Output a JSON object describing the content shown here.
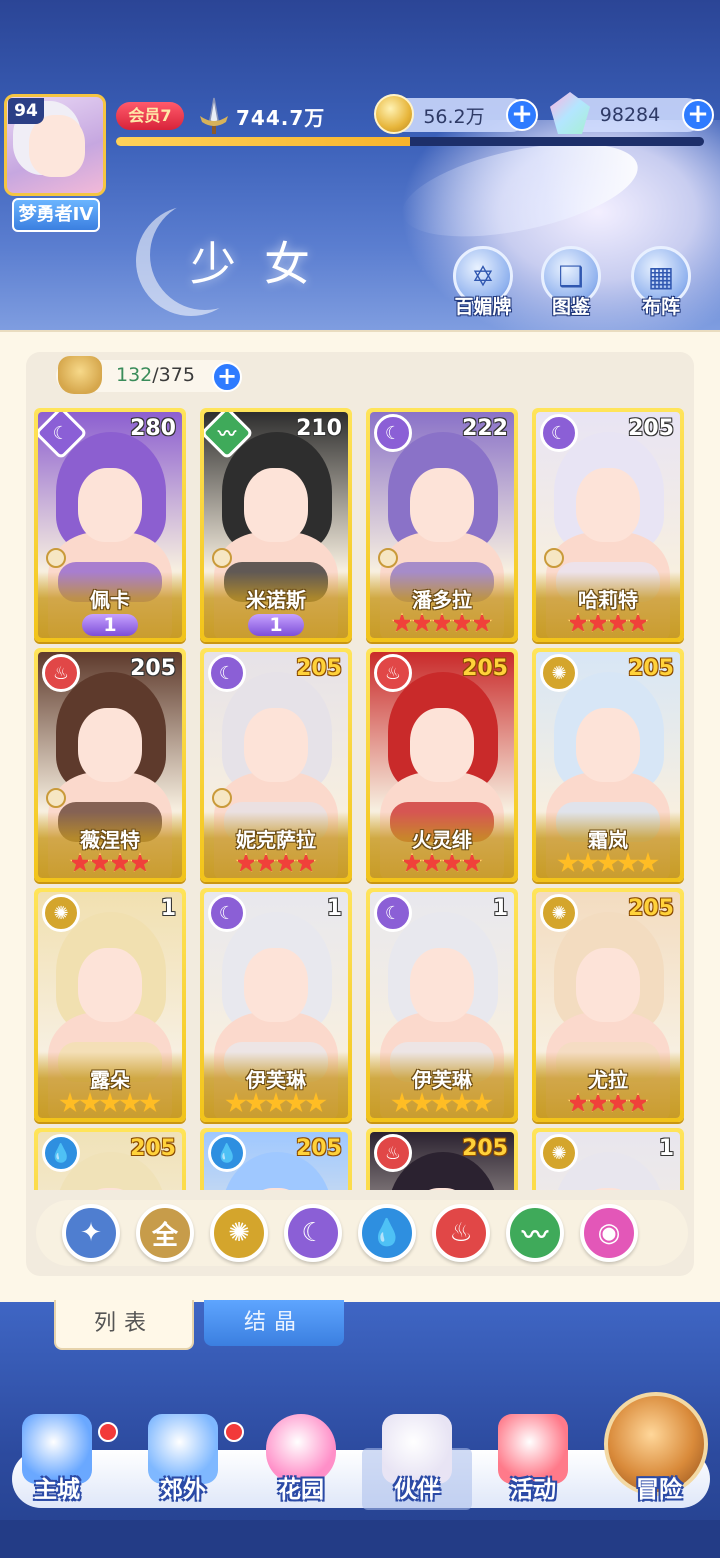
{
  "player": {
    "level": "94",
    "rank": "梦勇者IV",
    "vip": "会员7",
    "power": "744.7万",
    "exp_fraction": 0.5
  },
  "currencies": {
    "gold": "56.2万",
    "gems": "98284"
  },
  "page_title": "少女",
  "header_buttons": [
    {
      "label": "百媚牌",
      "icon": "card-icon"
    },
    {
      "label": "图鉴",
      "icon": "book-icon"
    },
    {
      "label": "布阵",
      "icon": "grid-icon"
    }
  ],
  "roster_count": {
    "current": "132",
    "max": "/375"
  },
  "cards": [
    {
      "name": "佩卡",
      "level": "280",
      "element": "moon",
      "rank": "wing",
      "wing_value": "1",
      "stars": 0,
      "star_color": "red",
      "tint": "#8c5fd0"
    },
    {
      "name": "米诺斯",
      "level": "210",
      "element": "wind",
      "rank": "wing",
      "wing_value": "1",
      "stars": 0,
      "star_color": "red",
      "tint": "#2e2e2e"
    },
    {
      "name": "潘多拉",
      "level": "222",
      "element": "moon",
      "rank": "stars",
      "stars": 5,
      "star_color": "red",
      "tint": "#8a72c8"
    },
    {
      "name": "哈莉特",
      "level": "205",
      "element": "moon",
      "rank": "stars",
      "stars": 4,
      "star_color": "red",
      "tint": "#e8e4f4"
    },
    {
      "name": "薇涅特",
      "level": "205",
      "element": "fire",
      "rank": "stars",
      "stars": 4,
      "star_color": "red",
      "tint": "#5e3a2c"
    },
    {
      "name": "妮克萨拉",
      "level": "205",
      "element": "moon",
      "rank": "stars",
      "stars": 4,
      "star_color": "red",
      "tint": "#e6e2e8"
    },
    {
      "name": "火灵绯",
      "level": "205",
      "element": "fire",
      "rank": "stars",
      "stars": 4,
      "star_color": "red",
      "tint": "#c92a2a"
    },
    {
      "name": "霜岚",
      "level": "205",
      "element": "sun",
      "rank": "stars",
      "stars": 5,
      "star_color": "gold",
      "tint": "#d7e6f6"
    },
    {
      "name": "露朵",
      "level": "1",
      "element": "sun",
      "rank": "stars",
      "stars": 5,
      "star_color": "gold",
      "tint": "#f1e0b0"
    },
    {
      "name": "伊芙琳",
      "level": "1",
      "element": "moon",
      "rank": "stars",
      "stars": 5,
      "star_color": "gold",
      "tint": "#e8e8ee"
    },
    {
      "name": "伊芙琳",
      "level": "1",
      "element": "moon",
      "rank": "stars",
      "stars": 5,
      "star_color": "gold",
      "tint": "#e8e8ee"
    },
    {
      "name": "尤拉",
      "level": "205",
      "element": "sun",
      "rank": "stars",
      "stars": 4,
      "star_color": "red",
      "tint": "#f3dcc0"
    },
    {
      "name": "",
      "level": "205",
      "element": "water",
      "rank": "none",
      "stars": 0,
      "star_color": "red",
      "tint": "#f0e2b8"
    },
    {
      "name": "",
      "level": "205",
      "element": "water",
      "rank": "none",
      "stars": 0,
      "star_color": "red",
      "tint": "#9fc8ff"
    },
    {
      "name": "",
      "level": "205",
      "element": "fire",
      "rank": "none",
      "stars": 0,
      "star_color": "red",
      "tint": "#2b2230"
    },
    {
      "name": "",
      "level": "1",
      "element": "sun",
      "rank": "none",
      "stars": 0,
      "star_color": "red",
      "tint": "#e8e6ee"
    }
  ],
  "element_glyphs": {
    "moon": "☾",
    "wind": "〰",
    "fire": "♨",
    "sun": "✺",
    "water": "💧"
  },
  "element_colors": {
    "moon": "#8b5fd6",
    "wind": "#3faa5a",
    "fire": "#e14747",
    "sun": "#d4a52c",
    "water": "#2e8fe0"
  },
  "filters": [
    {
      "label": "✦",
      "color": "#4f7ed0",
      "icon": "star-filter-icon"
    },
    {
      "label": "全",
      "color": "#c79c4a",
      "icon": "all-filter-icon"
    },
    {
      "label": "✺",
      "color": "#d4a52c",
      "icon": "sun-filter-icon"
    },
    {
      "label": "☾",
      "color": "#8b5fd6",
      "icon": "moon-filter-icon"
    },
    {
      "label": "💧",
      "color": "#2e8fe0",
      "icon": "water-filter-icon"
    },
    {
      "label": "♨",
      "color": "#e14747",
      "icon": "fire-filter-icon"
    },
    {
      "label": "〰",
      "color": "#3faa5a",
      "icon": "wind-filter-icon"
    },
    {
      "label": "◉",
      "color": "#e357b8",
      "icon": "dark-filter-icon"
    }
  ],
  "sub_tabs": {
    "list": "列表",
    "crystal": "结晶"
  },
  "nav": [
    {
      "label": "主城",
      "icon": "castle-icon",
      "dot": true
    },
    {
      "label": "郊外",
      "icon": "compass-icon",
      "dot": true
    },
    {
      "label": "花园",
      "icon": "heart-icon",
      "dot": false
    },
    {
      "label": "伙伴",
      "icon": "partner-icon",
      "dot": false
    },
    {
      "label": "活动",
      "icon": "gift-icon",
      "dot": false
    },
    {
      "label": "冒险",
      "icon": "adventure-icon",
      "dot": false
    }
  ]
}
